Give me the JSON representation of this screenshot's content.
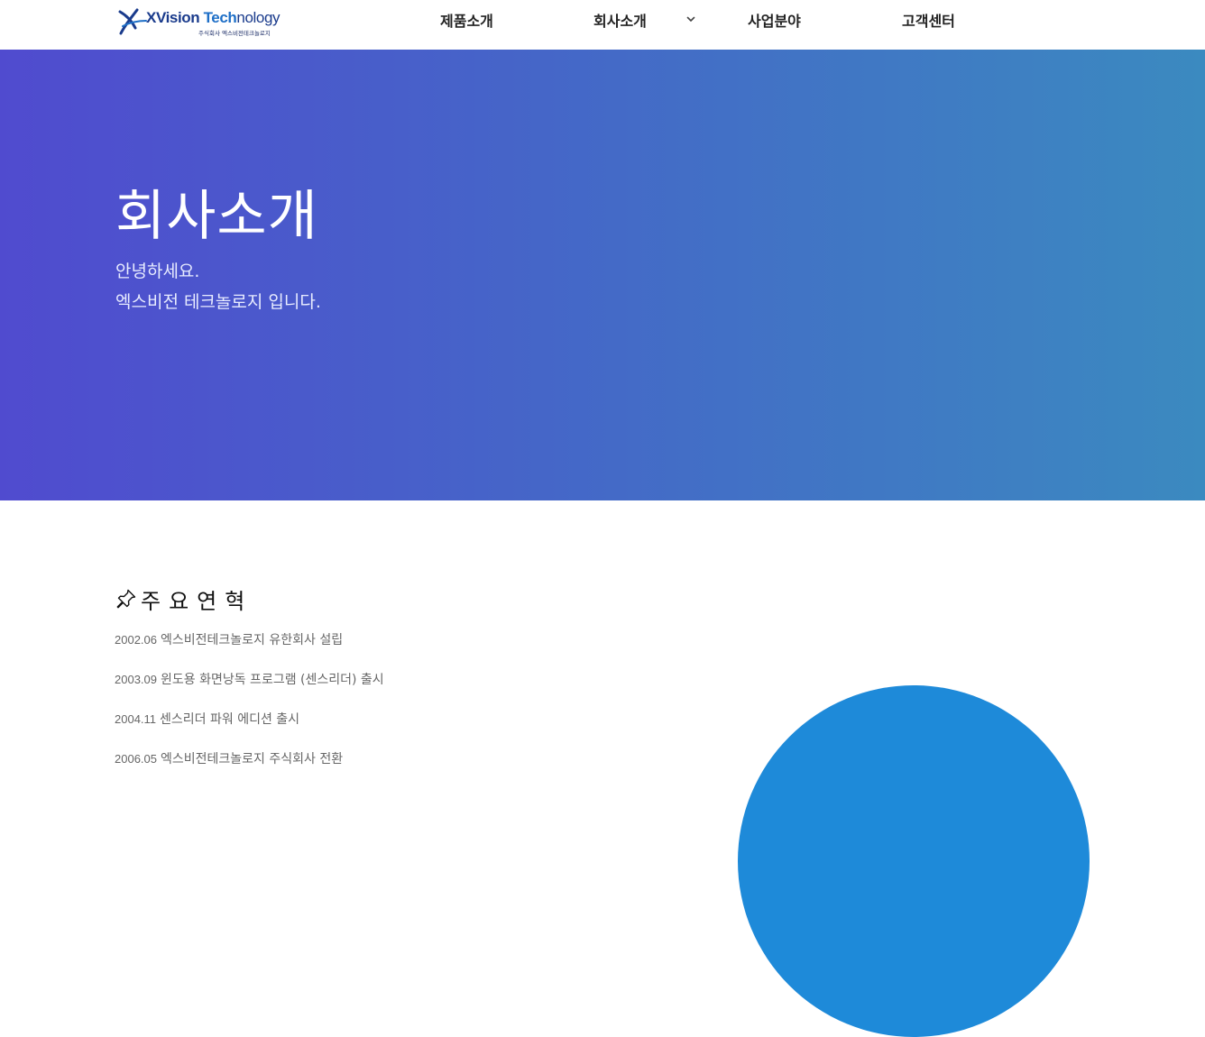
{
  "header": {
    "logo": {
      "title_part1": "XVision ",
      "title_part2": "Tech",
      "title_part3": "nology",
      "subtitle": "주식회사 엑스비전테크놀로지"
    },
    "nav": [
      {
        "label": "제품소개"
      },
      {
        "label": "회사소개"
      },
      {
        "label": "사업분야"
      },
      {
        "label": "고객센터"
      }
    ]
  },
  "hero": {
    "title": "회사소개",
    "line1": "안녕하세요.",
    "line2": "엑스비전 테크놀로지 입니다."
  },
  "history": {
    "title": "주요연혁",
    "items": [
      {
        "date": "2002.06",
        "text": "엑스비전테크놀로지 유한회사 설립"
      },
      {
        "date": "2003.09",
        "text": "윈도용 화면낭독 프로그램 (센스리더) 출시"
      },
      {
        "date": "2004.11",
        "text": "센스리더 파워 에디션 출시"
      },
      {
        "date": "2006.05",
        "text": "엑스비전테크놀로지 주식회사 전환"
      }
    ]
  },
  "colors": {
    "hero_gradient_start": "#504bcf",
    "hero_gradient_end": "#3b8ac0",
    "circle": "#1e8ad9",
    "brand_dark": "#1a3b8c",
    "brand_light": "#1e6fc7"
  },
  "icons": {
    "logo": "xvision-swoosh-logo",
    "caret": "chevron-down-icon",
    "pin": "pushpin-icon"
  }
}
